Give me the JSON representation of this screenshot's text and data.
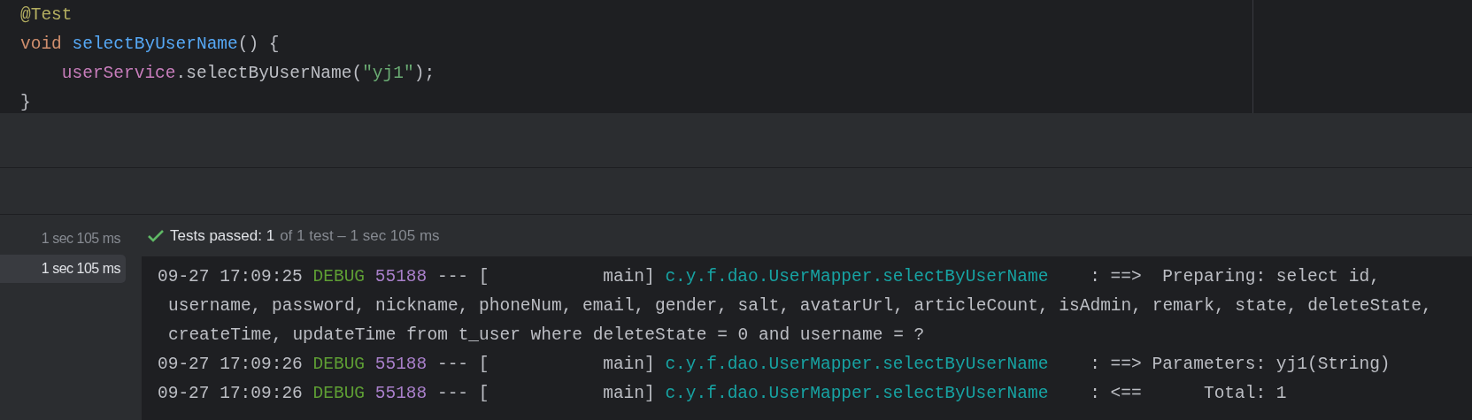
{
  "editor": {
    "lines": [
      [
        {
          "kind": "annotation",
          "text": "@Test"
        }
      ],
      [
        {
          "kind": "keyword",
          "text": "void "
        },
        {
          "kind": "method",
          "text": "selectByUserName"
        },
        {
          "kind": "plain",
          "text": "() {"
        }
      ],
      [
        {
          "kind": "field",
          "text": "    userService"
        },
        {
          "kind": "plain",
          "text": ".selectByUserName("
        },
        {
          "kind": "string",
          "text": "\"yj1\""
        },
        {
          "kind": "plain",
          "text": ");"
        }
      ],
      [
        {
          "kind": "plain",
          "text": "}"
        }
      ]
    ]
  },
  "test_tree": {
    "items": [
      {
        "label": "1 sec 105 ms",
        "selected": false
      },
      {
        "label": "1 sec 105 ms",
        "selected": true
      }
    ]
  },
  "test_status": {
    "passed": true,
    "label": "Tests passed: 1",
    "detail": "of 1 test – 1 sec 105 ms"
  },
  "console": {
    "entries": [
      {
        "time": "09-27 17:09:25",
        "level": "DEBUG",
        "pid": "55188",
        "separator": "--- [           main]",
        "logger": "c.y.f.dao.UserMapper.selectByUserName",
        "message": "    : ==>  Preparing: select id,",
        "continuation": [
          "username, password, nickname, phoneNum, email, gender, salt, avatarUrl, articleCount, isAdmin, remark, state, deleteState,",
          "createTime, updateTime from t_user where deleteState = 0 and username = ?"
        ]
      },
      {
        "time": "09-27 17:09:26",
        "level": "DEBUG",
        "pid": "55188",
        "separator": "--- [           main]",
        "logger": "c.y.f.dao.UserMapper.selectByUserName",
        "message": "    : ==> Parameters: yj1(String)"
      },
      {
        "time": "09-27 17:09:26",
        "level": "DEBUG",
        "pid": "55188",
        "separator": "--- [           main]",
        "logger": "c.y.f.dao.UserMapper.selectByUserName",
        "message": "    : <==      Total: 1"
      }
    ]
  }
}
